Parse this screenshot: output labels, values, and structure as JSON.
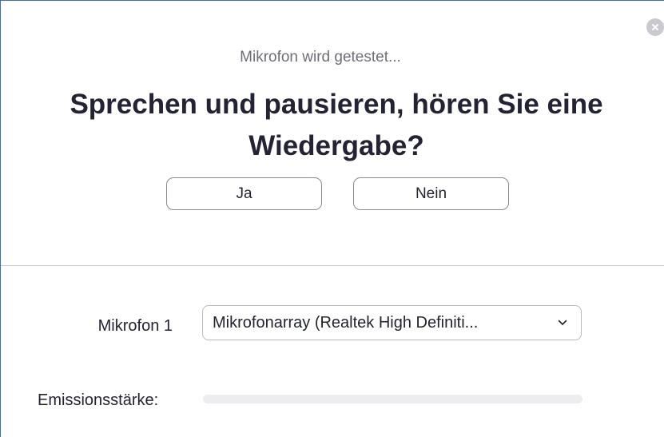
{
  "dialog": {
    "status_text": "Mikrofon wird getestet...",
    "question_line1": "Sprechen und pausieren, hören Sie eine",
    "question_line2": "Wiedergabe?",
    "yes_label": "Ja",
    "no_label": "Nein",
    "close_icon": "close-icon"
  },
  "microphone": {
    "label": "Mikrofon 1",
    "selected_device": "Mikrofonarray (Realtek High Definiti...",
    "dropdown_icon": "chevron-down-icon"
  },
  "emission": {
    "label": "Emissionsstärke:",
    "level_fraction": 0.0
  },
  "colors": {
    "window_border": "#3b6fb6",
    "text_primary": "#232333",
    "text_secondary": "#6e6e78",
    "level_track": "#ededf0",
    "close_button": "#c9c9cf"
  }
}
